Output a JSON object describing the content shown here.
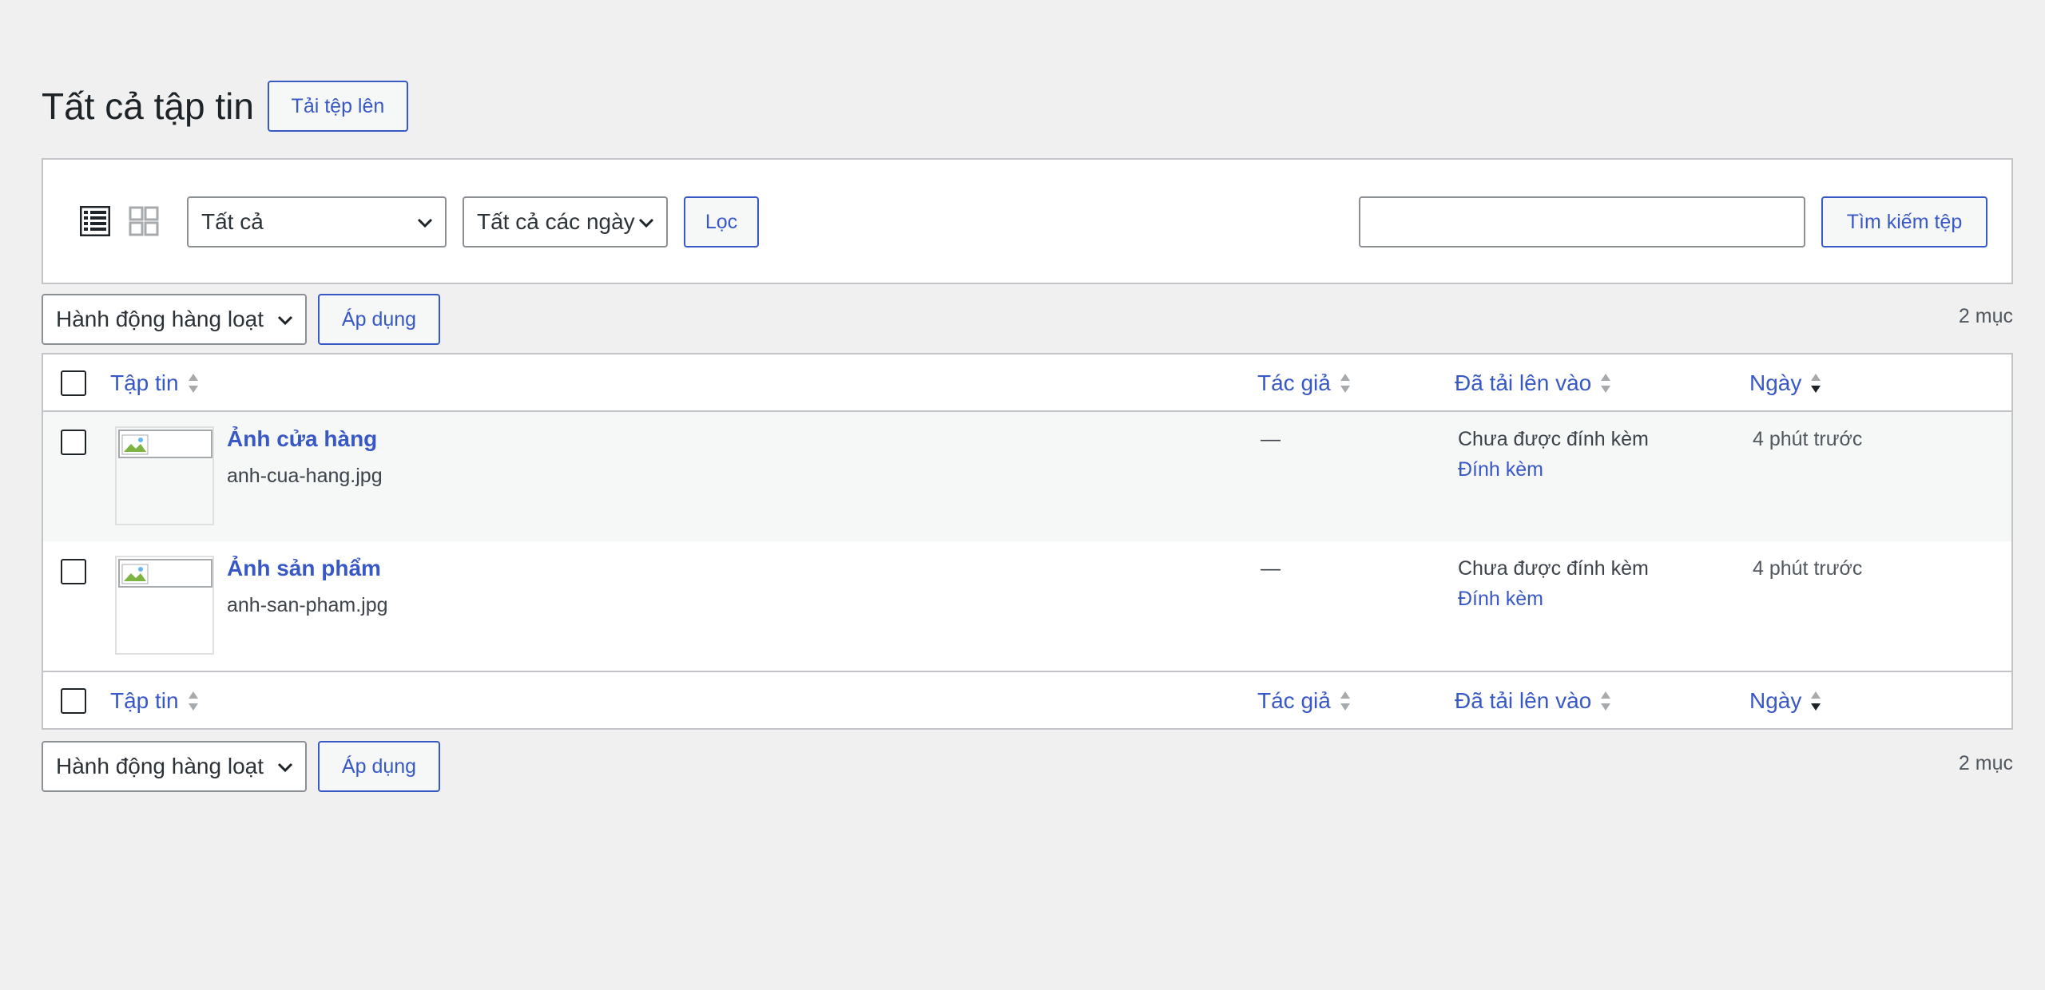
{
  "header": {
    "title": "Tất cả tập tin",
    "upload_label": "Tải tệp lên"
  },
  "filters": {
    "type_selected": "Tất cả",
    "date_selected": "Tất cả các ngày",
    "filter_label": "Lọc",
    "search_value": "",
    "search_button": "Tìm kiếm tệp"
  },
  "bulk": {
    "action_selected": "Hành động hàng loạt",
    "apply_label": "Áp dụng",
    "count_label": "2 mục"
  },
  "columns": {
    "file": "Tập tin",
    "author": "Tác giả",
    "uploaded_to": "Đã tải lên vào",
    "date": "Ngày"
  },
  "rows": [
    {
      "title": "Ảnh cửa hàng",
      "filename": "anh-cua-hang.jpg",
      "author": "—",
      "uploaded_status": "Chưa được đính kèm",
      "attach_label": "Đính kèm",
      "date": "4 phút trước"
    },
    {
      "title": "Ảnh sản phẩm",
      "filename": "anh-san-pham.jpg",
      "author": "—",
      "uploaded_status": "Chưa được đính kèm",
      "attach_label": "Đính kèm",
      "date": "4 phút trước"
    }
  ],
  "colors": {
    "link": "#3858c6",
    "background": "#f0f0f1",
    "border": "#c3c4c7"
  },
  "icons": {
    "list_view": "list-view-icon",
    "grid_view": "grid-view-icon",
    "sort": "sort-arrows-icon",
    "chevron": "chevron-down-icon"
  }
}
